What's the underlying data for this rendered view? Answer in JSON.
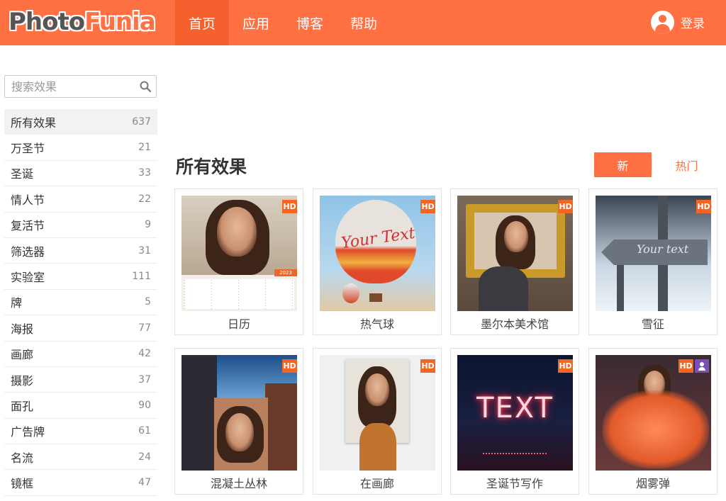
{
  "header": {
    "logo_part1": "Photo",
    "logo_part2": "Funia",
    "nav": [
      "首页",
      "应用",
      "博客",
      "帮助"
    ],
    "login": "登录"
  },
  "search": {
    "placeholder": "搜索效果"
  },
  "categories": [
    {
      "label": "所有效果",
      "count": "637"
    },
    {
      "label": "万圣节",
      "count": "21"
    },
    {
      "label": "圣诞",
      "count": "33"
    },
    {
      "label": "情人节",
      "count": "22"
    },
    {
      "label": "复活节",
      "count": "9"
    },
    {
      "label": "筛选器",
      "count": "31"
    },
    {
      "label": "实验室",
      "count": "111"
    },
    {
      "label": "牌",
      "count": "5"
    },
    {
      "label": "海报",
      "count": "77"
    },
    {
      "label": "画廊",
      "count": "42"
    },
    {
      "label": "摄影",
      "count": "37"
    },
    {
      "label": "面孔",
      "count": "90"
    },
    {
      "label": "广告牌",
      "count": "61"
    },
    {
      "label": "名流",
      "count": "24"
    },
    {
      "label": "镜框",
      "count": "47"
    }
  ],
  "main": {
    "title": "所有效果",
    "sort_new": "新",
    "sort_hot": "热门",
    "hd_badge": "HD",
    "calendar_year": "2023",
    "balloon_text": "Your Text",
    "snow_text": "Your text",
    "neon_text": "TEXT",
    "cards": [
      "日历",
      "热气球",
      "墨尔本美术馆",
      "雪征",
      "混凝土丛林",
      "在画廊",
      "圣诞节写作",
      "烟雾弹"
    ]
  },
  "colors": {
    "brand": "#ff7043",
    "brand_active": "#f4602e",
    "hd_badge": "#f26522",
    "user_badge": "#7b4fb8"
  }
}
